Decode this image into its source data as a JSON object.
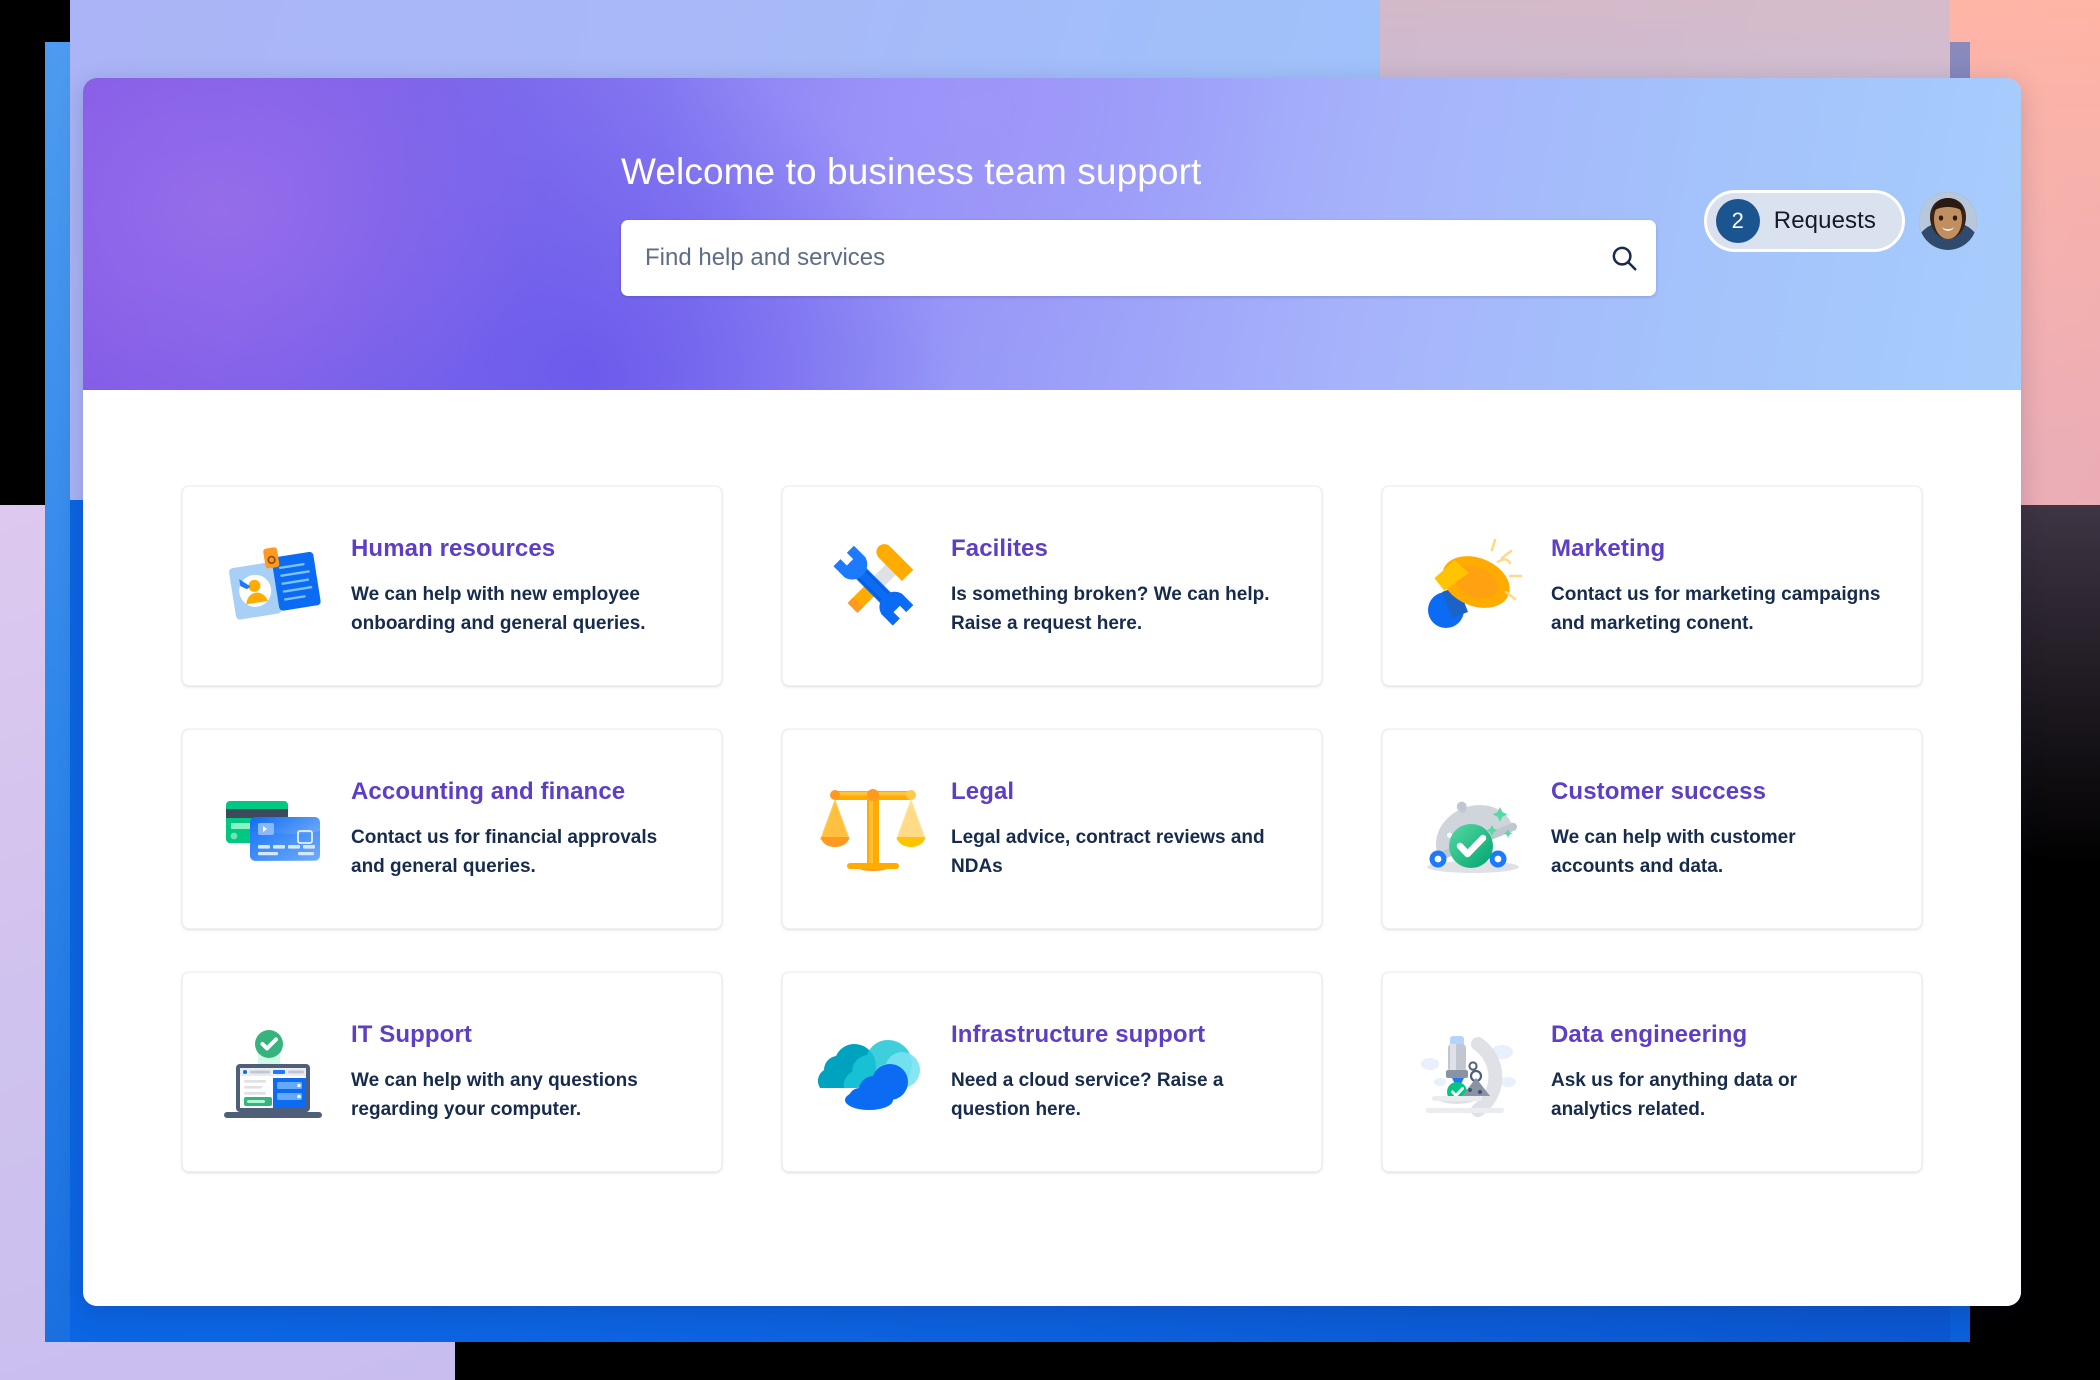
{
  "header": {
    "title": "Welcome to business team support",
    "search": {
      "placeholder": "Find help and services",
      "value": "",
      "icon": "search-icon"
    },
    "requests": {
      "count": "2",
      "label": "Requests"
    },
    "avatar": {
      "alt": "User profile photo"
    }
  },
  "colors": {
    "heading_purple": "#5E3EC5",
    "body_navy": "#172B4D",
    "badge_blue": "#1B558F",
    "frame_blue": "#0B57D0",
    "hero_purple": "#8257E5",
    "hero_blue": "#A6CDFC",
    "peach": "#FFBFB0",
    "lavender": "#CFC2EE"
  },
  "services": [
    {
      "title": "Human resources",
      "description": "We can help with new employee onboarding and general queries.",
      "icon": "id-badge-icon"
    },
    {
      "title": "Facilites",
      "description": "Is something broken? We can help. Raise a request here.",
      "icon": "hammer-wrench-icon"
    },
    {
      "title": "Marketing",
      "description": "Contact us for marketing campaigns and marketing conent.",
      "icon": "megaphone-icon"
    },
    {
      "title": "Accounting and finance",
      "description": "Contact us for financial approvals and general queries.",
      "icon": "credit-cards-icon"
    },
    {
      "title": "Legal",
      "description": "Legal advice, contract reviews and NDAs",
      "icon": "scales-of-justice-icon"
    },
    {
      "title": "Customer success",
      "description": "We can help with customer accounts and data.",
      "icon": "service-dome-check-icon"
    },
    {
      "title": "IT Support",
      "description": "We can help with any questions regarding your computer.",
      "icon": "laptop-check-icon"
    },
    {
      "title": "Infrastructure support",
      "description": "Need a cloud service? Raise a question here.",
      "icon": "cloud-icon"
    },
    {
      "title": "Data engineering",
      "description": "Ask us for anything data or analytics related.",
      "icon": "microscope-icon"
    }
  ]
}
